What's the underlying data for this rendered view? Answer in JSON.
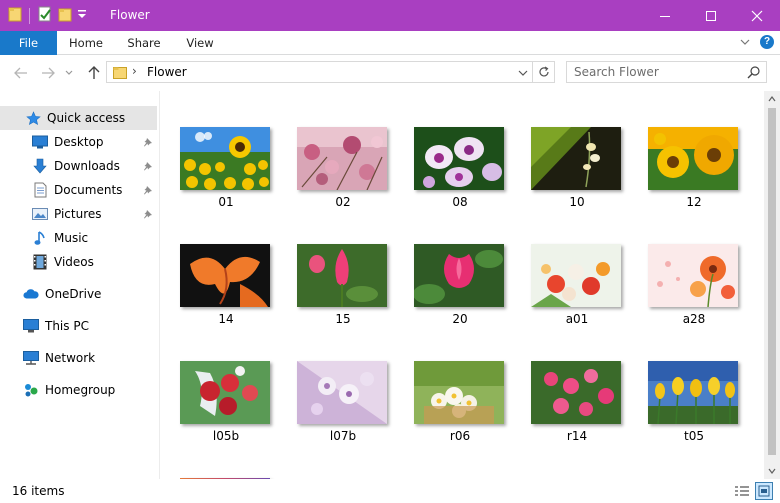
{
  "window": {
    "title": "Flower",
    "accent_color": "#a93fc1"
  },
  "ribbon": {
    "tabs": [
      "File",
      "Home",
      "Share",
      "View"
    ],
    "help_label": "?"
  },
  "address": {
    "path": "Flower",
    "separator": "›"
  },
  "search": {
    "placeholder": "Search Flower"
  },
  "nav": {
    "quick_access": "Quick access",
    "items": [
      {
        "label": "Desktop",
        "icon": "desktop-icon",
        "pinned": true
      },
      {
        "label": "Downloads",
        "icon": "download-arrow-icon",
        "pinned": true
      },
      {
        "label": "Documents",
        "icon": "document-icon",
        "pinned": true
      },
      {
        "label": "Pictures",
        "icon": "pictures-icon",
        "pinned": true
      },
      {
        "label": "Music",
        "icon": "music-note-icon",
        "pinned": false
      },
      {
        "label": "Videos",
        "icon": "film-icon",
        "pinned": false
      }
    ],
    "onedrive": "OneDrive",
    "this_pc": "This PC",
    "network": "Network",
    "homegroup": "Homegroup"
  },
  "files": [
    {
      "name": "01"
    },
    {
      "name": "02"
    },
    {
      "name": "08"
    },
    {
      "name": "10"
    },
    {
      "name": "12"
    },
    {
      "name": "14"
    },
    {
      "name": "15"
    },
    {
      "name": "20"
    },
    {
      "name": "a01"
    },
    {
      "name": "a28"
    },
    {
      "name": "l05b"
    },
    {
      "name": "l07b"
    },
    {
      "name": "r06"
    },
    {
      "name": "r14"
    },
    {
      "name": "t05"
    }
  ],
  "status": {
    "item_count": "16 items"
  }
}
